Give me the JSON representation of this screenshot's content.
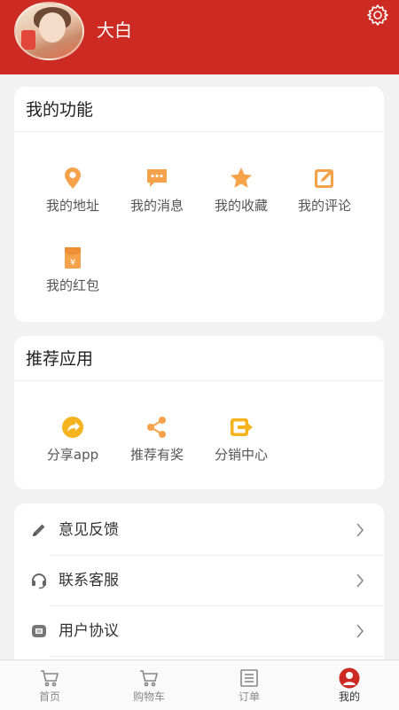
{
  "header": {
    "username": "大白",
    "bg_color": "#cc2a22"
  },
  "functions": {
    "title": "我的功能",
    "items": [
      {
        "label": "我的地址",
        "icon": "location-pin-icon"
      },
      {
        "label": "我的消息",
        "icon": "chat-bubble-icon"
      },
      {
        "label": "我的收藏",
        "icon": "star-icon"
      },
      {
        "label": "我的评论",
        "icon": "edit-icon"
      },
      {
        "label": "我的红包",
        "icon": "red-packet-icon"
      }
    ]
  },
  "recommend": {
    "title": "推荐应用",
    "items": [
      {
        "label": "分享app",
        "icon": "share-arrow-icon"
      },
      {
        "label": "推荐有奖",
        "icon": "share-nodes-icon"
      },
      {
        "label": "分销中心",
        "icon": "export-box-icon"
      }
    ]
  },
  "settings_list": [
    {
      "label": "意见反馈",
      "icon": "pencil-icon"
    },
    {
      "label": "联系客服",
      "icon": "headset-icon"
    },
    {
      "label": "用户协议",
      "icon": "document-icon"
    }
  ],
  "tabbar": [
    {
      "label": "首页",
      "icon": "cart-icon"
    },
    {
      "label": "购物车",
      "icon": "cart-icon"
    },
    {
      "label": "订单",
      "icon": "list-icon"
    },
    {
      "label": "我的",
      "icon": "user-icon",
      "active": true
    }
  ],
  "colors": {
    "accent_orange": "#f5a24a",
    "brand_red": "#cc2a22"
  }
}
